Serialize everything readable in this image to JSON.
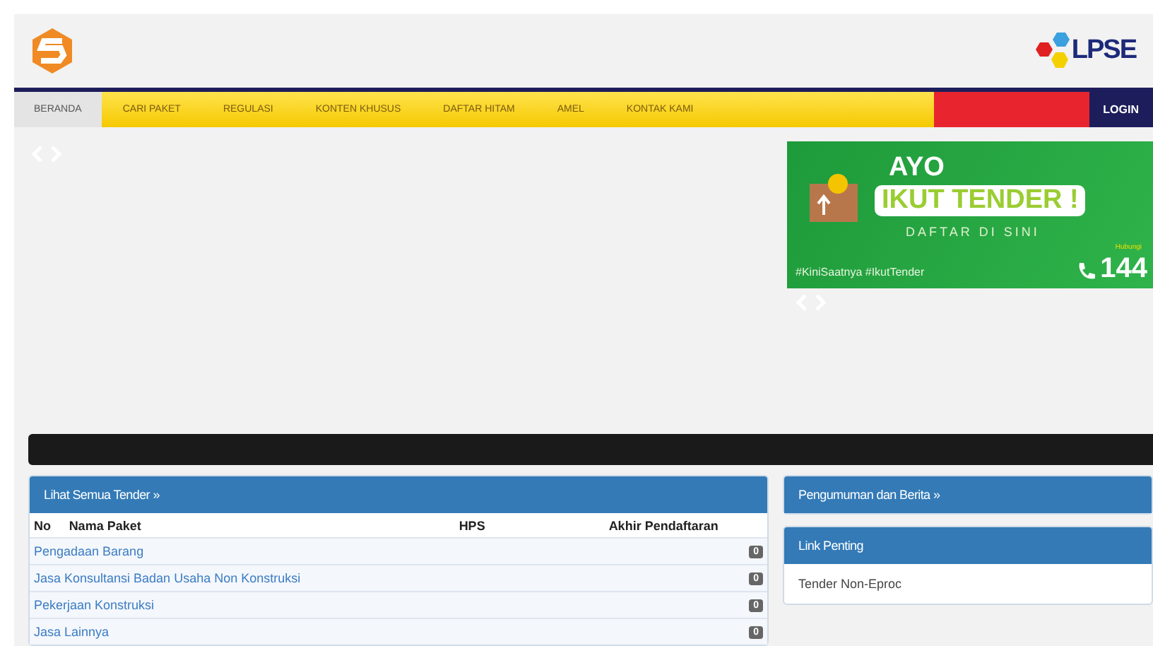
{
  "header": {
    "logo_text": "LPSE"
  },
  "nav": {
    "items": [
      {
        "label": "BERANDA",
        "selected": true
      },
      {
        "label": "CARI PAKET",
        "selected": false
      },
      {
        "label": "REGULASI",
        "selected": false
      },
      {
        "label": "KONTEN KHUSUS",
        "selected": false
      },
      {
        "label": "DAFTAR HITAM",
        "selected": false
      },
      {
        "label": "AMEL",
        "selected": false
      },
      {
        "label": "KONTAK KAMI",
        "selected": false
      }
    ],
    "login": "LOGIN"
  },
  "banner": {
    "line1": "AYO",
    "line2": "IKUT TENDER !",
    "line3": "DAFTAR DI SINI",
    "hashtags": "#KiniSaatnya #IkutTender",
    "hotline_label": "Hubungi",
    "hotline": "144"
  },
  "tender_panel": {
    "title": "Lihat Semua Tender »",
    "columns": [
      "No",
      "Nama Paket",
      "HPS",
      "Akhir Pendaftaran"
    ],
    "rows": [
      {
        "name": "Pengadaan Barang",
        "count": "0"
      },
      {
        "name": "Jasa Konsultansi Badan Usaha Non Konstruksi",
        "count": "0"
      },
      {
        "name": "Pekerjaan Konstruksi",
        "count": "0"
      },
      {
        "name": "Jasa Lainnya",
        "count": "0"
      }
    ]
  },
  "news_panel": {
    "title": "Pengumuman dan Berita »"
  },
  "links_panel": {
    "title": "Link Penting",
    "items": [
      "Tender Non-Eproc"
    ]
  }
}
